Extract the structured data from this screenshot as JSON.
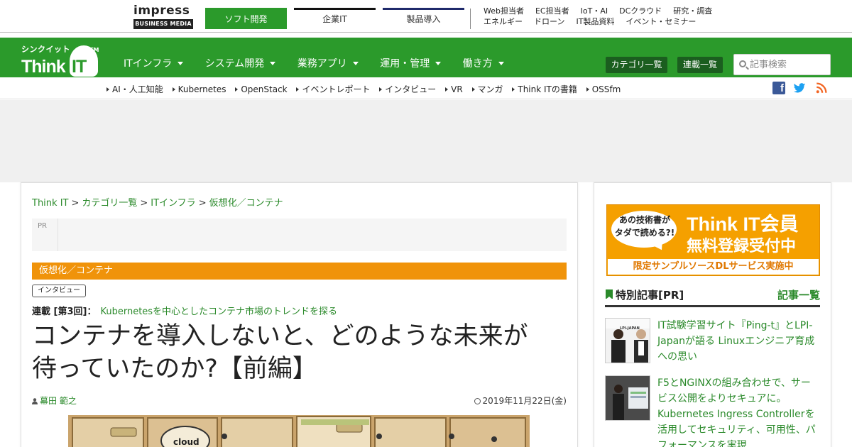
{
  "impress": {
    "logo_word": "impress",
    "logo_sub": "BUSINESS MEDIA",
    "tabs": [
      {
        "label": "ソフト開発",
        "active": true
      },
      {
        "label": "企業IT",
        "active": false
      },
      {
        "label": "製品導入",
        "active": false
      }
    ],
    "links_row1": [
      "Web担当者",
      "EC担当者",
      "IoT・AI",
      "DCクラウド",
      "研究・調査"
    ],
    "links_row2": [
      "エネルギー",
      "ドローン",
      "IT製品資料",
      "イベント・セミナー"
    ]
  },
  "logo": {
    "kana": "シンクイット",
    "think": "Think",
    "it": "IT",
    "tm": "TM"
  },
  "nav": {
    "items": [
      "ITインフラ",
      "システム開発",
      "業務アプリ",
      "運用・管理",
      "働き方"
    ],
    "category_button": "カテゴリ一覧",
    "series_button": "連載一覧",
    "search_placeholder": "記事検索"
  },
  "subnav": {
    "items": [
      "AI・人工知能",
      "Kubernetes",
      "OpenStack",
      "イベントレポート",
      "インタビュー",
      "VR",
      "マンガ",
      "Think ITの書籍",
      "OSSfm"
    ]
  },
  "breadcrumb": {
    "items": [
      "Think IT",
      "カテゴリ一覧",
      "ITインフラ",
      "仮想化／コンテナ"
    ],
    "separator": ">"
  },
  "pr_label": "PR",
  "article": {
    "category": "仮想化／コンテナ",
    "tag": "インタビュー",
    "series_label": "連載 [第3回]：",
    "series_title": "Kubernetesを中心としたコンテナ市場のトレンドを探る",
    "title_line1": "コンテナを導入しないと、どのような未来が",
    "title_line2": "待っていたのか?【前編】",
    "author": "幕田 範之",
    "date": "2019年11月22日(金)",
    "hero_text": "cloud"
  },
  "sidebar": {
    "banner": {
      "bubble": "あの技術書が\nタダで読める?!",
      "line1": "Think IT会員",
      "line2": "無料登録受付中",
      "line3": "限定サンプルソースDLサービス実施中"
    },
    "special_label": "特別記事[PR]",
    "all_link": "記事一覧",
    "items": [
      {
        "text": "IT試験学習サイト『Ping-t』とLPI-Japanが語る Linuxエンジニア育成への思い",
        "thumb_text": "LPI-JAPAN"
      },
      {
        "text": "F5とNGINXの組み合わせで、サービス公開をよりセキュアに。Kubernetes Ingress Controllerを活用してセキュリティ、可用性、パフォーマンスを実現"
      }
    ]
  },
  "colors": {
    "brand_green": "#2b9a2b",
    "category_orange": "#f0930a",
    "link_green": "#2b8a2b"
  }
}
